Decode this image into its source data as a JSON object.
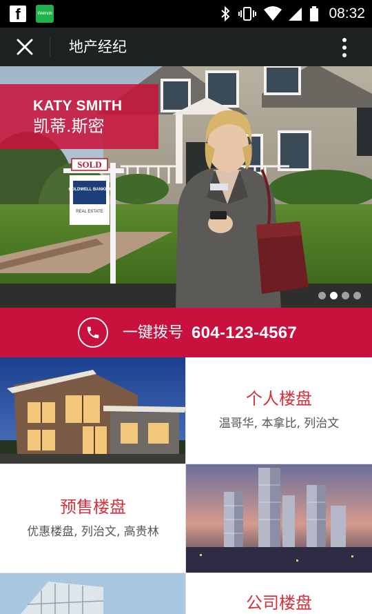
{
  "status_bar": {
    "left_icons": [
      "facebook-icon",
      "weimob-icon"
    ],
    "weimob_label": "Weimob",
    "right_icons": [
      "bluetooth-icon",
      "vibrate-icon",
      "wifi-icon",
      "cell-signal-icon",
      "battery-icon"
    ],
    "time": "08:32"
  },
  "app_bar": {
    "title": "地产经纪",
    "close_icon": "close-icon",
    "menu_icon": "more-vert-icon"
  },
  "hero": {
    "agent_name_en": "KATY SMITH",
    "agent_name_zh": "凯蒂.斯密",
    "sign_sold": "SOLD",
    "sign_brand": "COLDWELL BANKER",
    "sign_sub": "REAL ESTATE",
    "slide_count": 4,
    "active_slide": 2
  },
  "call_bar": {
    "icon": "phone-icon",
    "label": "一键拨号",
    "number": "604-123-4567"
  },
  "tiles": [
    {
      "title": "个人楼盘",
      "subtitle": "温哥华, 本拿比, 列治文"
    },
    {
      "title": "预售楼盘",
      "subtitle": "优惠楼盘, 列治文, 高贵林"
    },
    {
      "title": "公司楼盘",
      "subtitle": ""
    }
  ],
  "colors": {
    "accent": "#c9113e",
    "tile_title": "#d4313d",
    "app_bar": "#1f2223"
  }
}
